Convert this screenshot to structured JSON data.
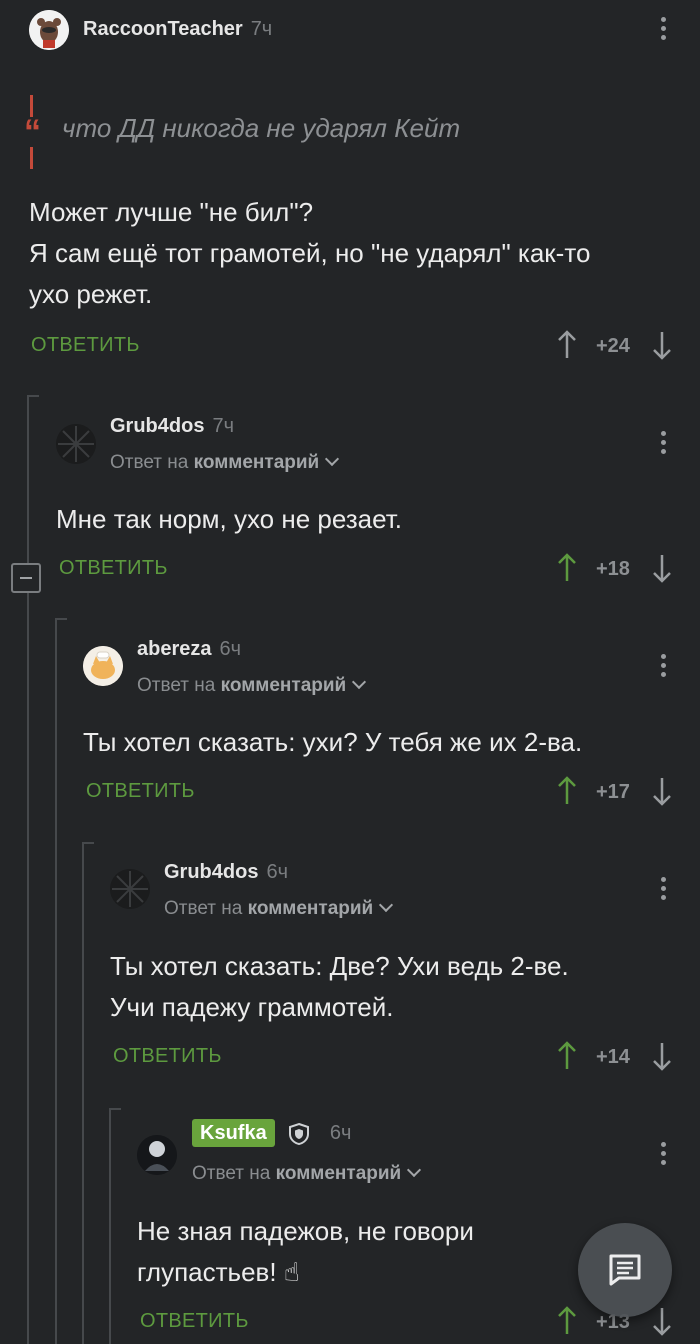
{
  "colors": {
    "background": "#232527",
    "accent_green": "#5d9a3f",
    "badge_green": "#69a43c",
    "quote_red": "#c44a3a"
  },
  "icons": {
    "options": "vertical-dots-icon",
    "upvote": "arrow-up-icon",
    "downvote": "arrow-down-icon",
    "collapse": "minus-box-icon",
    "chat": "chat-bubble-icon",
    "shield": "shield-icon"
  },
  "comments": [
    {
      "author": "RaccoonTeacher",
      "time": "7ч",
      "quote": "что ДД никогда не ударял Кейт",
      "lines": [
        "Может лучше \"не бил\"?",
        "Я сам ещё тот грамотей, но \"не ударял\" как-то",
        "ухо режет."
      ],
      "reply_label": "ОТВЕТИТЬ",
      "rating": "+24"
    },
    {
      "author": "Grub4dos",
      "time": "7ч",
      "reply_to_prefix": "Ответ на",
      "reply_to_target": "комментарий",
      "lines": [
        "Мне так норм, ухо не резает."
      ],
      "reply_label": "ОТВЕТИТЬ",
      "rating": "+18"
    },
    {
      "author": "abereza",
      "time": "6ч",
      "reply_to_prefix": "Ответ на",
      "reply_to_target": "комментарий",
      "lines": [
        "Ты хотел сказать: ухи? У тебя же их 2-ва."
      ],
      "reply_label": "ОТВЕТИТЬ",
      "rating": "+17"
    },
    {
      "author": "Grub4dos",
      "time": "6ч",
      "reply_to_prefix": "Ответ на",
      "reply_to_target": "комментарий",
      "lines": [
        "Ты хотел сказать: Две? Ухи ведь 2-ве.",
        "Учи падежу граммотей."
      ],
      "reply_label": "ОТВЕТИТЬ",
      "rating": "+14"
    },
    {
      "author": "Ksufka",
      "time": "6ч",
      "reply_to_prefix": "Ответ на",
      "reply_to_target": "комментарий",
      "lines": [
        "Не зная падежов, не говори",
        "глупастьев! ☝"
      ],
      "reply_label": "ОТВЕТИТЬ",
      "rating": "+13"
    }
  ]
}
